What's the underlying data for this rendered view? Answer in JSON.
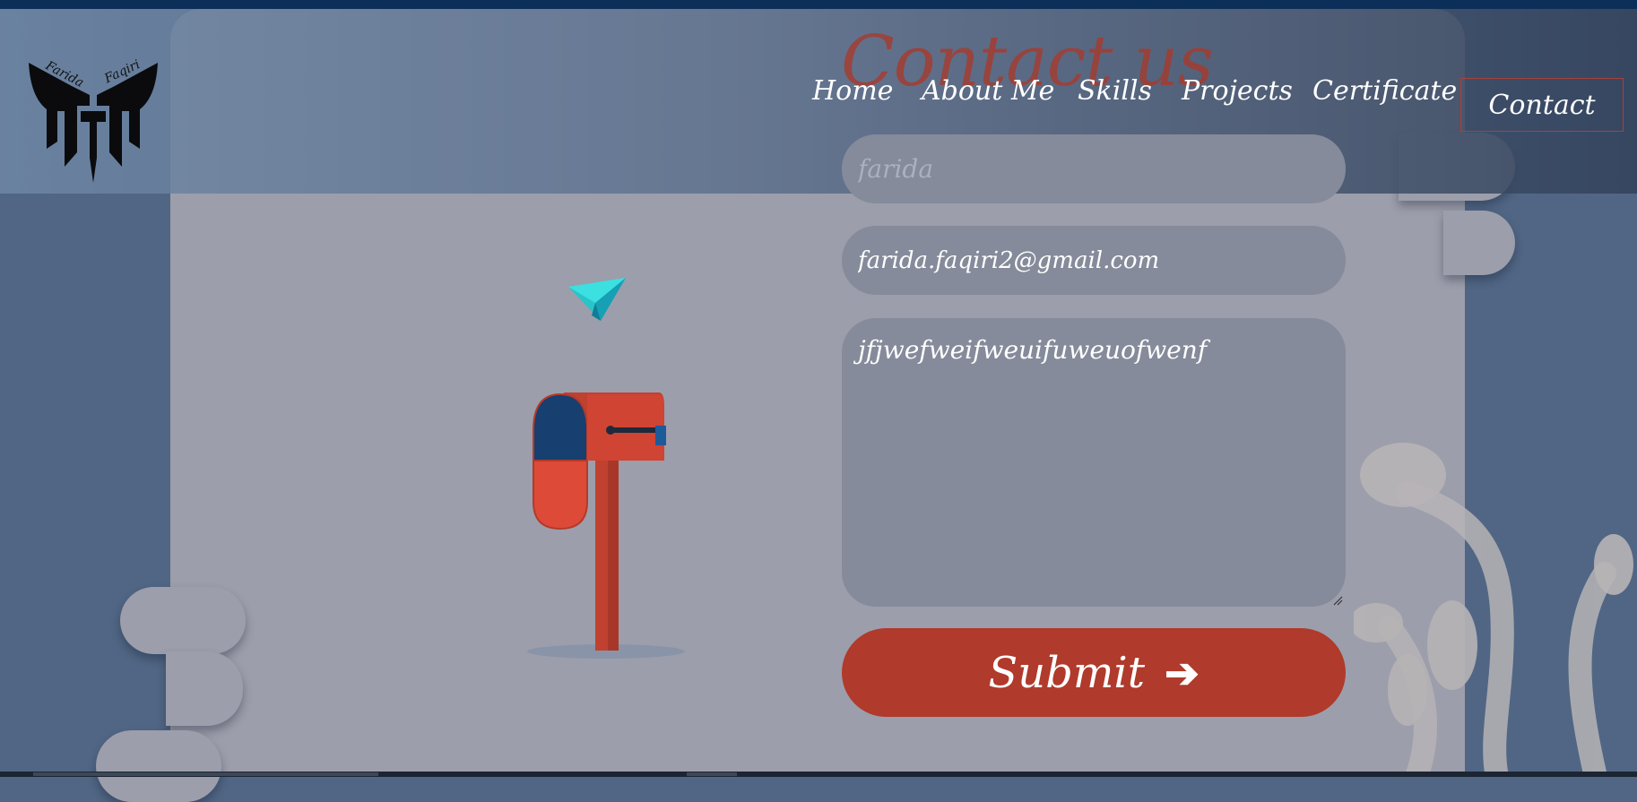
{
  "page": {
    "title": "Contact us"
  },
  "logo": {
    "line1": "Farida",
    "line2": "Faqiri",
    "icon": "ff-wings-logo"
  },
  "nav": {
    "items": [
      {
        "label": "Home"
      },
      {
        "label": "About Me"
      },
      {
        "label": "Skills"
      },
      {
        "label": "Projects"
      },
      {
        "label": "Certificate"
      },
      {
        "label": "Contact",
        "active": true
      }
    ]
  },
  "form": {
    "name_placeholder": "farida",
    "email_value": "farida.faqiri2@gmail.com",
    "message_value": "jfjwefweifweuifuweuofwenf",
    "submit_label": "Submit",
    "submit_icon": "arrow-right-icon"
  },
  "illustration": {
    "items": [
      "paper-plane-icon",
      "mailbox-icon"
    ]
  },
  "colors": {
    "accent": "#b03a2b",
    "panel": "#9c9eab",
    "background": "#506684",
    "field": "#858b9a"
  }
}
